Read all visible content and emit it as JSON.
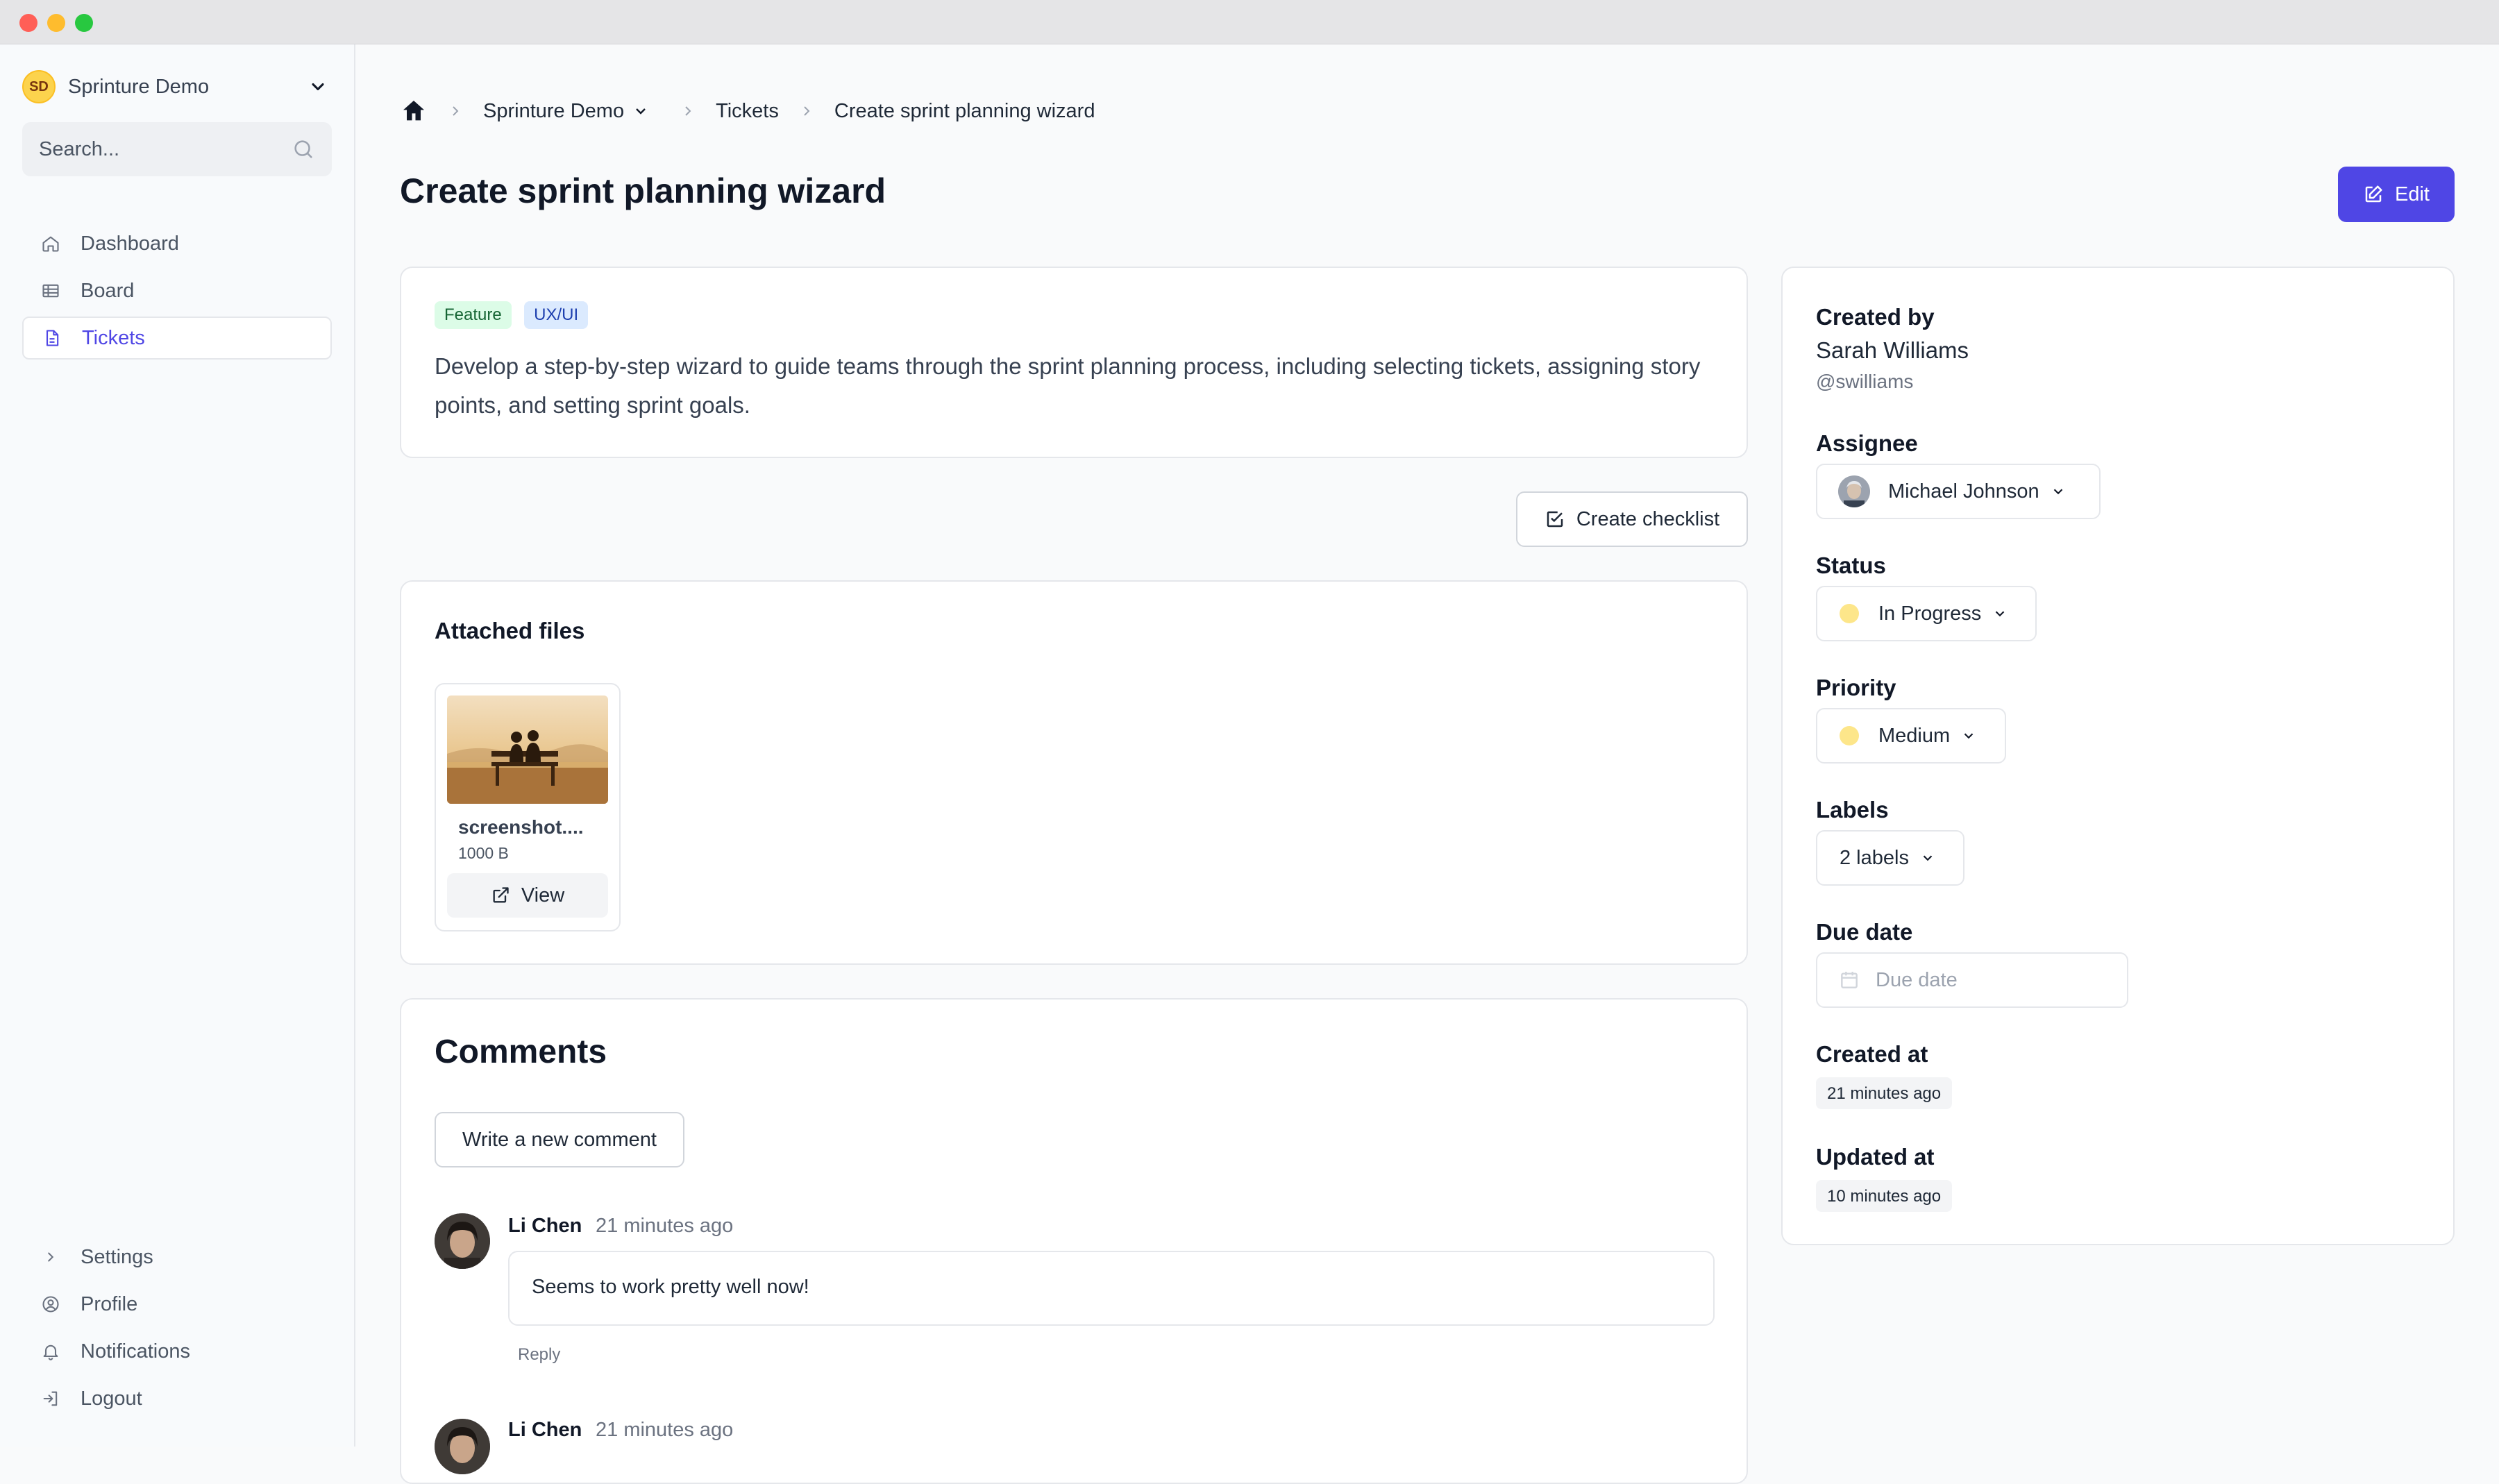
{
  "window": {
    "close_color": "#ff5f57",
    "min_color": "#febc2e",
    "max_color": "#28c840"
  },
  "sidebar": {
    "workspace_initials": "SD",
    "workspace_name": "Sprinture Demo",
    "search_placeholder": "Search...",
    "nav": [
      {
        "label": "Dashboard",
        "icon": "home-icon"
      },
      {
        "label": "Board",
        "icon": "table-icon"
      },
      {
        "label": "Tickets",
        "icon": "document-icon",
        "active": true
      }
    ],
    "bottom_nav": [
      {
        "label": "Settings",
        "icon": "chevron-right-icon"
      },
      {
        "label": "Profile",
        "icon": "user-circle-icon"
      },
      {
        "label": "Notifications",
        "icon": "bell-icon"
      },
      {
        "label": "Logout",
        "icon": "logout-icon"
      }
    ]
  },
  "breadcrumb": {
    "project": "Sprinture Demo",
    "section": "Tickets",
    "current": "Create sprint planning wizard"
  },
  "ticket": {
    "title": "Create sprint planning wizard",
    "edit_label": "Edit",
    "tags": [
      {
        "label": "Feature",
        "bg": "#dcfce7",
        "fg": "#166534"
      },
      {
        "label": "UX/UI",
        "bg": "#dbeafe",
        "fg": "#1e40af"
      }
    ],
    "description": "Develop a step-by-step wizard to guide teams through the sprint planning process, including selecting tickets, assigning story points, and setting sprint goals.",
    "create_checklist_label": "Create checklist"
  },
  "attachments": {
    "heading": "Attached files",
    "files": [
      {
        "name": "screenshot....",
        "size": "1000 B",
        "view_label": "View"
      }
    ]
  },
  "comments": {
    "heading": "Comments",
    "new_comment_label": "Write a new comment",
    "items": [
      {
        "author": "Li Chen",
        "time": "21 minutes ago",
        "text": "Seems to work pretty well now!",
        "reply_label": "Reply"
      },
      {
        "author": "Li Chen",
        "time": "21 minutes ago"
      }
    ]
  },
  "details": {
    "created_by_label": "Created by",
    "created_by_name": "Sarah Williams",
    "created_by_handle": "@swilliams",
    "assignee_label": "Assignee",
    "assignee": "Michael Johnson",
    "status_label": "Status",
    "status": "In Progress",
    "priority_label": "Priority",
    "priority": "Medium",
    "labels_label": "Labels",
    "labels_value": "2 labels",
    "due_date_label": "Due date",
    "due_date_placeholder": "Due date",
    "created_at_label": "Created at",
    "created_at": "21 minutes ago",
    "updated_at_label": "Updated at",
    "updated_at": "10 minutes ago"
  },
  "colors": {
    "accent": "#4f46e5",
    "status_dot": "#fde68a"
  }
}
